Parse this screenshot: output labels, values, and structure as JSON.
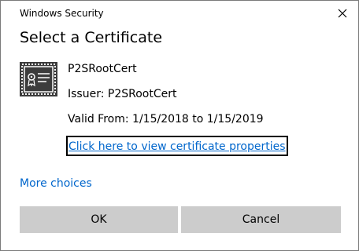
{
  "window": {
    "title": "Windows Security",
    "close_icon": "close-icon"
  },
  "dialog": {
    "heading": "Select a Certificate",
    "certificate": {
      "icon": "certificate-icon",
      "name": "P2SRootCert",
      "issuer": "Issuer: P2SRootCert",
      "valid": "Valid From: 1/15/2018 to 1/15/2019",
      "properties_link": "Click here to view certificate properties"
    },
    "more_choices": "More choices",
    "ok_label": "OK",
    "cancel_label": "Cancel"
  },
  "colors": {
    "link": "#0066cc",
    "button_bg": "#cccccc",
    "border": "#7a7a7a"
  }
}
